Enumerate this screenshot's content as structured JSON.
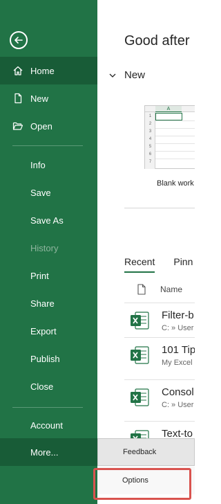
{
  "sidebar": {
    "items": [
      {
        "label": "Home",
        "icon": "home-icon"
      },
      {
        "label": "New",
        "icon": "new-file-icon"
      },
      {
        "label": "Open",
        "icon": "folder-open-icon"
      },
      {
        "label": "Info"
      },
      {
        "label": "Save"
      },
      {
        "label": "Save As"
      },
      {
        "label": "History"
      },
      {
        "label": "Print"
      },
      {
        "label": "Share"
      },
      {
        "label": "Export"
      },
      {
        "label": "Publish"
      },
      {
        "label": "Close"
      },
      {
        "label": "Account"
      },
      {
        "label": "More..."
      }
    ]
  },
  "main": {
    "greeting": "Good after",
    "new_section": "New",
    "blank_label": "Blank work",
    "thumbnail": {
      "col": "A",
      "rows": [
        "1",
        "2",
        "3",
        "4",
        "5",
        "6",
        "7"
      ]
    },
    "tabs": [
      "Recent",
      "Pinn"
    ],
    "column_name": "Name",
    "files": [
      {
        "name": "Filter-b",
        "path": "C: » User"
      },
      {
        "name": "101 Tip",
        "path": "My Excel"
      },
      {
        "name": "Consol",
        "path": "C: » User"
      },
      {
        "name": "Text-to",
        "path": ""
      }
    ]
  },
  "menu": {
    "feedback": "Feedback",
    "options": "Options"
  },
  "colors": {
    "sidebar": "#217346",
    "sidebar_active": "#185c37",
    "highlight": "#d9534f"
  }
}
